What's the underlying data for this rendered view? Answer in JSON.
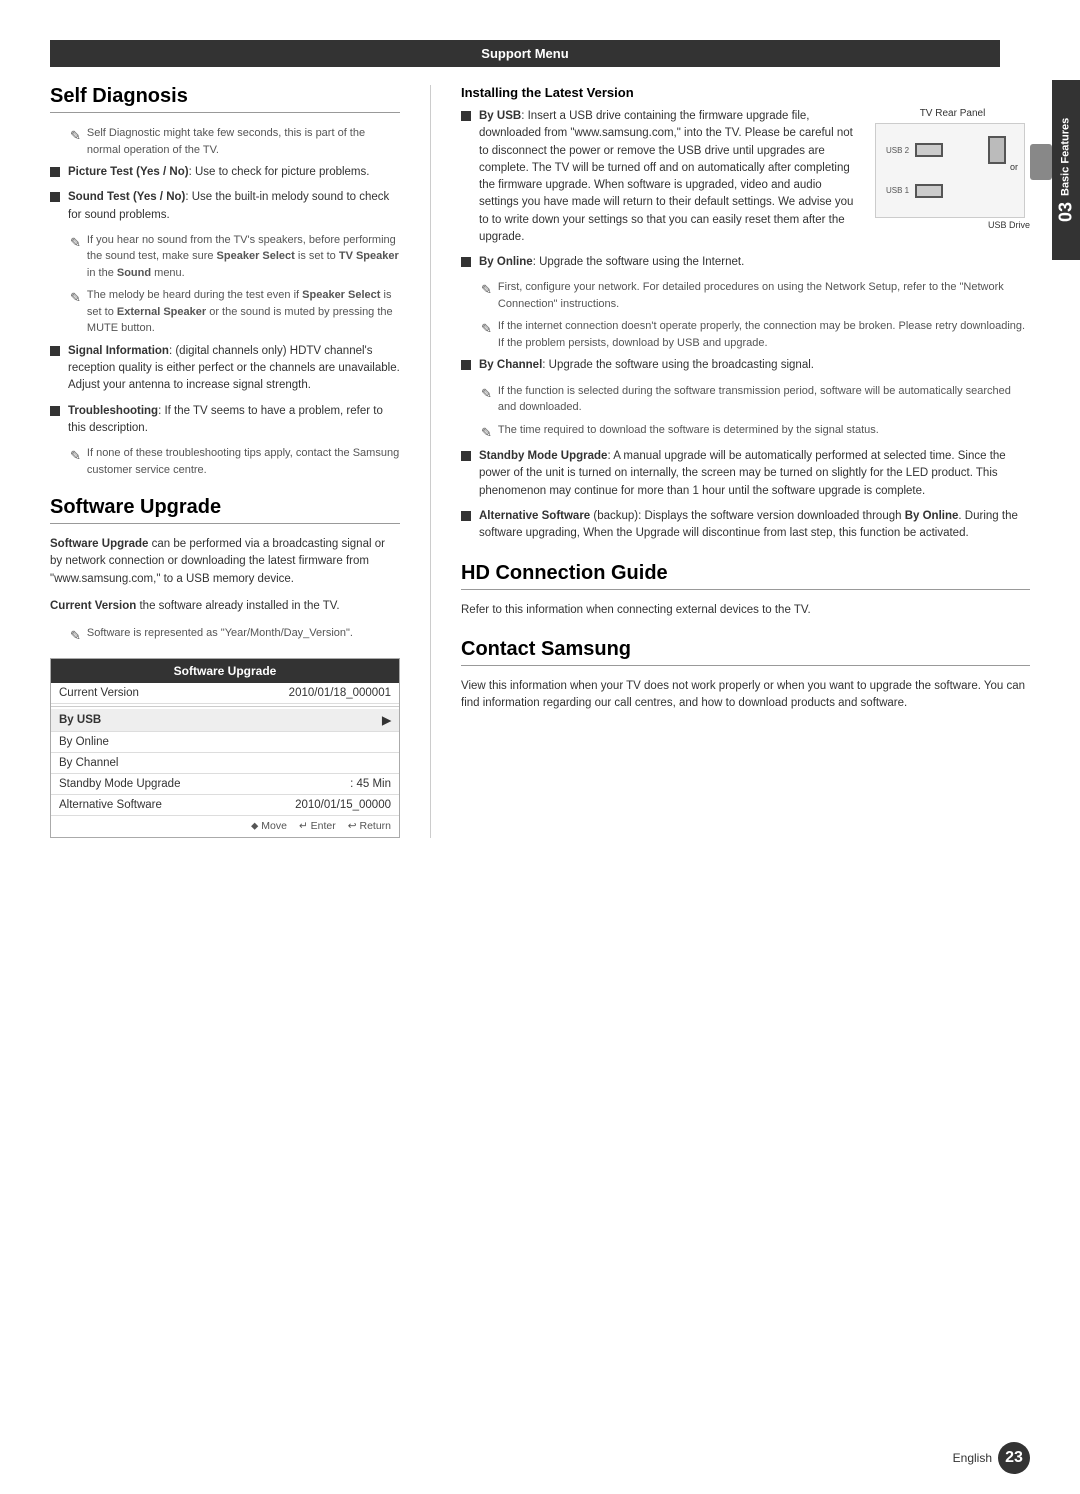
{
  "page": {
    "number": "23",
    "language": "English",
    "chapter_number": "03",
    "chapter_title": "Basic Features"
  },
  "support_menu": {
    "header": "Support Menu"
  },
  "self_diagnosis": {
    "title": "Self Diagnosis",
    "intro_note": "Self Diagnostic might take few seconds, this is part of the normal operation of the TV.",
    "bullets": [
      {
        "id": "picture-test",
        "text_bold": "Picture Test (Yes / No)",
        "text_rest": ": Use to check for picture problems.",
        "notes": []
      },
      {
        "id": "sound-test",
        "text_bold": "Sound Test (Yes / No)",
        "text_rest": ": Use the built-in melody sound to check for sound problems.",
        "notes": [
          "If you hear no sound from the TV's speakers, before performing the sound test, make sure Speaker Select is set to TV Speaker in the Sound menu.",
          "The melody will be heard during the test even if Speaker Select is set to External Speaker or the sound is muted by pressing the MUTE button."
        ],
        "notes_bold": [
          "",
          "Speaker Select"
        ],
        "notes_bold2": [
          "Speaker Select",
          "External Speaker"
        ]
      },
      {
        "id": "signal-info",
        "text_bold": "Signal Information",
        "text_rest": ": (digital channels only) HDTV channel's reception quality is either perfect or the channels are unavailable. Adjust your antenna to increase signal strength.",
        "notes": []
      },
      {
        "id": "troubleshooting",
        "text_bold": "Troubleshooting",
        "text_rest": ": If the TV seems to have a problem, refer to this description.",
        "notes": [
          "If none of these troubleshooting tips apply, contact the Samsung customer service centre."
        ]
      }
    ]
  },
  "software_upgrade": {
    "title": "Software Upgrade",
    "intro": "Software Upgrade can be performed via a broadcasting signal or by network connection or downloading the latest firmware from \"www.samsung.com,\" to a USB memory device.",
    "current_version_label": "Current Version",
    "current_version_text": "the software already installed in the TV.",
    "note": "Software is represented as \"Year/Month/Day_Version\".",
    "table_header": "Software Upgrade",
    "table_rows": [
      {
        "label": "Current Version",
        "value": "2010/01/18_000001"
      },
      {
        "label": "By USB",
        "value": "▶",
        "highlight": true
      },
      {
        "label": "By Online",
        "value": ""
      },
      {
        "label": "By Channel",
        "value": ""
      },
      {
        "label": "Standby Mode Upgrade",
        "value": ": 45 Min"
      },
      {
        "label": "Alternative Software",
        "value": "2010/01/15_00000"
      }
    ],
    "nav_labels": [
      "⬥ Move",
      "↵ Enter",
      "↩ Return"
    ]
  },
  "installing_latest": {
    "title": "Installing the Latest Version",
    "by_usb": {
      "label": "By USB",
      "text": ": Insert a USB drive containing the firmware upgrade file, downloaded from \"www.samsung.com,\" into the TV. Please be careful not to disconnect the power or remove the USB drive until upgrades are complete. The TV will be turned off and on automatically after completing the firmware upgrade. When software is upgraded, video and audio settings you have made will return to their default settings. We advise you to to write down your settings so that you can easily reset them after the upgrade."
    },
    "tv_rear_panel_label": "TV Rear Panel",
    "usb_drive_label": "USB Drive",
    "or_label": "or",
    "by_online": {
      "label": "By Online",
      "text": ": Upgrade the software using the Internet.",
      "notes": [
        "First, configure your network. For detailed procedures on using the Network Setup, refer to the \"Network Connection\" instructions.",
        "If the internet connection doesn't operate properly, the connection may be broken. Please retry downloading. If the problem persists, download by USB and upgrade."
      ]
    },
    "by_channel": {
      "label": "By Channel",
      "text": ": Upgrade the software using the broadcasting signal.",
      "notes": [
        "If the function is selected during the software transmission period, software will be automatically searched and downloaded.",
        "The time required to download the software is determined by the signal status."
      ]
    },
    "standby_mode": {
      "label": "Standby Mode Upgrade",
      "text": ": A manual upgrade will be automatically performed at selected time. Since the power of the unit is turned on internally, the screen may be turned on slightly for the LED product. This phenomenon may continue for more than 1 hour until the software upgrade is complete."
    },
    "alternative_software": {
      "label": "Alternative Software",
      "text_before": " (backup): Displays the software version downloaded through ",
      "text_bold": "By Online",
      "text_after": ". During the software upgrading, When the Upgrade will discontinue from last step, this function be activated."
    }
  },
  "hd_connection": {
    "title": "HD Connection Guide",
    "text": "Refer to this information when connecting external devices to the TV."
  },
  "contact_samsung": {
    "title": "Contact Samsung",
    "text": "View this information when your TV does not work properly or when you want to upgrade the software. You can find information regarding our call centres, and how to download products and software."
  }
}
